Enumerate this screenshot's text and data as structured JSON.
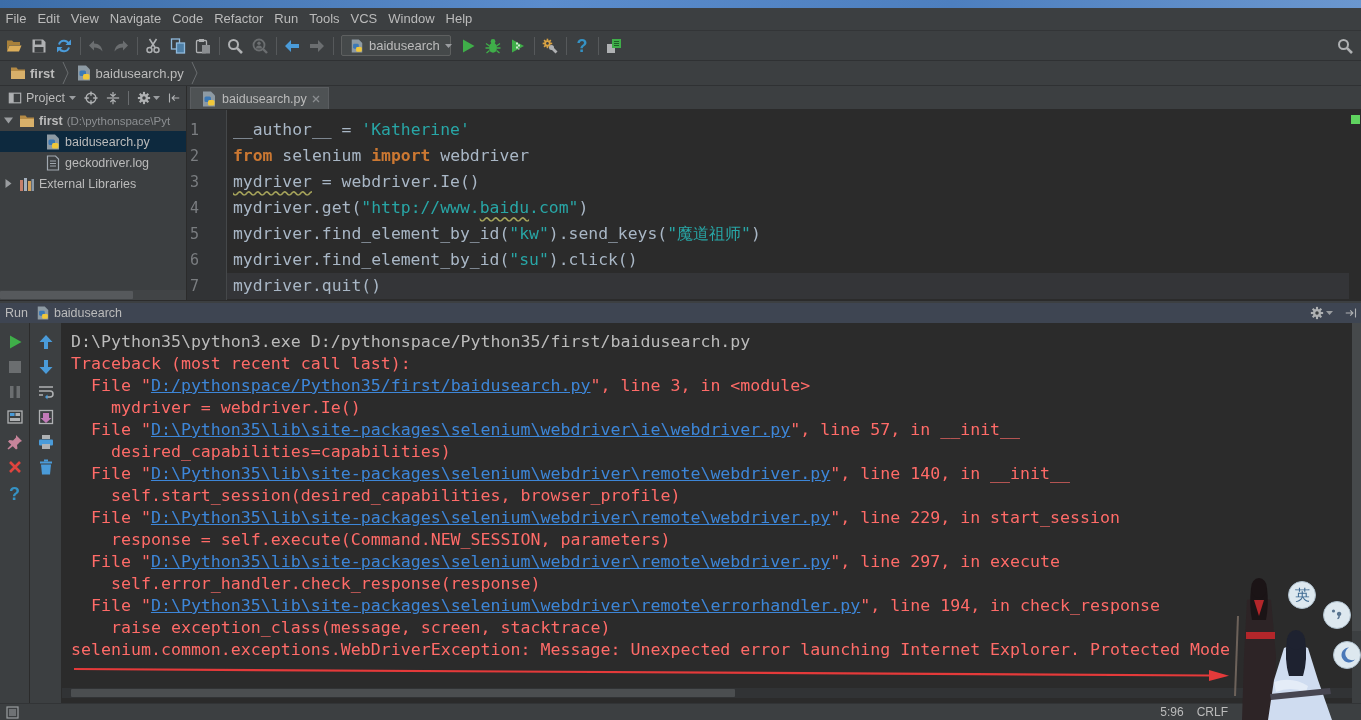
{
  "menu_bar": {
    "items": [
      "File",
      "Edit",
      "View",
      "Navigate",
      "Code",
      "Refactor",
      "Run",
      "Tools",
      "VCS",
      "Window",
      "Help"
    ]
  },
  "toolbar": {
    "groups": [
      [
        {
          "kind": "open",
          "disabled": false
        },
        {
          "kind": "save",
          "disabled": false
        },
        {
          "kind": "sync",
          "disabled": false
        }
      ],
      [
        {
          "kind": "undo",
          "disabled": true
        },
        {
          "kind": "redo",
          "disabled": true
        }
      ],
      [
        {
          "kind": "cut",
          "disabled": false
        },
        {
          "kind": "copy",
          "disabled": false
        },
        {
          "kind": "paste",
          "disabled": false
        }
      ],
      [
        {
          "kind": "find",
          "disabled": false
        },
        {
          "kind": "replace",
          "disabled": true
        }
      ],
      [
        {
          "kind": "back",
          "disabled": false
        },
        {
          "kind": "forward",
          "disabled": true
        }
      ],
      [
        {
          "kind": "run_config",
          "label": "baidusearch",
          "disabled": false
        },
        {
          "kind": "run",
          "disabled": false
        },
        {
          "kind": "debug",
          "disabled": false
        },
        {
          "kind": "coverage",
          "disabled": false
        }
      ],
      [
        {
          "kind": "settings",
          "disabled": false
        }
      ],
      [
        {
          "kind": "help",
          "glyph": "?",
          "disabled": false
        }
      ],
      [
        {
          "kind": "sdk",
          "disabled": false
        }
      ]
    ]
  },
  "navigation_bar": {
    "crumbs": [
      {
        "kind": "project",
        "label": "first"
      },
      {
        "kind": "python",
        "label": "baidusearch.py"
      }
    ]
  },
  "project_panel": {
    "title": "Project",
    "tree": [
      {
        "kind": "project",
        "label": "first",
        "path": "(D:\\pythonspace\\Pyt",
        "expanded": true,
        "selected": false,
        "children": [
          {
            "kind": "python",
            "label": "baidusearch.py",
            "selected": true
          },
          {
            "kind": "log",
            "label": "geckodriver.log",
            "selected": false
          }
        ]
      },
      {
        "kind": "library",
        "label": "External Libraries",
        "expanded": false,
        "selected": false
      }
    ]
  },
  "editor": {
    "tabs": [
      {
        "label": "baidusearch.py",
        "selected": true
      }
    ],
    "lines": [
      {
        "number": "1",
        "current": false,
        "tokens": [
          {
            "kind": "plain",
            "text": "__author__ = "
          },
          {
            "kind": "string",
            "text": "'Katherine'"
          }
        ]
      },
      {
        "number": "2",
        "current": false,
        "tokens": [
          {
            "kind": "keyword",
            "text": "from"
          },
          {
            "kind": "plain",
            "text": " selenium "
          },
          {
            "kind": "keyword",
            "text": "import"
          },
          {
            "kind": "plain",
            "text": " webdriver"
          }
        ]
      },
      {
        "number": "3",
        "current": false,
        "tokens": [
          {
            "kind": "typo",
            "text": "mydriver"
          },
          {
            "kind": "plain",
            "text": " = webdriver.Ie()"
          }
        ]
      },
      {
        "number": "4",
        "current": false,
        "tokens": [
          {
            "kind": "plain",
            "text": "mydriver.get("
          },
          {
            "kind": "string",
            "text": "\"http://www."
          },
          {
            "kind": "string_typo",
            "text": "baidu"
          },
          {
            "kind": "string",
            "text": ".com\""
          },
          {
            "kind": "plain",
            "text": ")"
          }
        ]
      },
      {
        "number": "5",
        "current": false,
        "tokens": [
          {
            "kind": "plain",
            "text": "mydriver.find_element_by_id("
          },
          {
            "kind": "string",
            "text": "\"kw\""
          },
          {
            "kind": "plain",
            "text": ").send_keys("
          },
          {
            "kind": "string",
            "text": "\"魔道祖师\""
          },
          {
            "kind": "plain",
            "text": ")"
          }
        ]
      },
      {
        "number": "6",
        "current": false,
        "tokens": [
          {
            "kind": "plain",
            "text": "mydriver.find_element_by_id("
          },
          {
            "kind": "string",
            "text": "\"su\""
          },
          {
            "kind": "plain",
            "text": ").click()"
          }
        ]
      },
      {
        "number": "7",
        "current": true,
        "tokens": [
          {
            "kind": "plain",
            "text": "mydriver.quit()"
          }
        ]
      }
    ]
  },
  "run_panel": {
    "title": "Run",
    "config": "baidusearch",
    "left_tools": [
      {
        "kind": "rerun",
        "disabled": false
      },
      {
        "kind": "stop",
        "disabled": true
      },
      {
        "kind": "pause",
        "disabled": true
      },
      {
        "kind": "layout",
        "disabled": false
      },
      {
        "kind": "pin",
        "disabled": false
      },
      {
        "kind": "close",
        "disabled": false
      },
      {
        "kind": "help",
        "glyph": "?",
        "disabled": false
      }
    ],
    "right_tools": [
      {
        "kind": "up",
        "disabled": false
      },
      {
        "kind": "down",
        "disabled": false
      },
      {
        "kind": "wrap",
        "disabled": false
      },
      {
        "kind": "scroll_end",
        "disabled": false
      },
      {
        "kind": "print",
        "disabled": false
      },
      {
        "kind": "trash",
        "disabled": false
      }
    ],
    "console": [
      {
        "kind": "command",
        "text": "D:\\Python35\\python3.exe D:/pythonspace/Python35/first/baidusearch.py"
      },
      {
        "kind": "error",
        "text": "Traceback (most recent call last):"
      },
      {
        "kind": "frame",
        "before": "File \"",
        "link": "D:/pythonspace/Python35/first/baidusearch.py",
        "after": "\", line 3, in <module>"
      },
      {
        "kind": "source",
        "text": "mydriver = webdriver.Ie()"
      },
      {
        "kind": "frame",
        "before": "File \"",
        "link": "D:\\Python35\\lib\\site-packages\\selenium\\webdriver\\ie\\webdriver.py",
        "after": "\", line 57, in __init__"
      },
      {
        "kind": "source",
        "text": "desired_capabilities=capabilities)"
      },
      {
        "kind": "frame",
        "before": "File \"",
        "link": "D:\\Python35\\lib\\site-packages\\selenium\\webdriver\\remote\\webdriver.py",
        "after": "\", line 140, in __init__"
      },
      {
        "kind": "source",
        "text": "self.start_session(desired_capabilities, browser_profile)"
      },
      {
        "kind": "frame",
        "before": "File \"",
        "link": "D:\\Python35\\lib\\site-packages\\selenium\\webdriver\\remote\\webdriver.py",
        "after": "\", line 229, in start_session"
      },
      {
        "kind": "source",
        "text": "response = self.execute(Command.NEW_SESSION, parameters)"
      },
      {
        "kind": "frame",
        "before": "File \"",
        "link": "D:\\Python35\\lib\\site-packages\\selenium\\webdriver\\remote\\webdriver.py",
        "after": "\", line 297, in execute"
      },
      {
        "kind": "source",
        "text": "self.error_handler.check_response(response)"
      },
      {
        "kind": "frame",
        "before": "File \"",
        "link": "D:\\Python35\\lib\\site-packages\\selenium\\webdriver\\remote\\errorhandler.py",
        "after": "\", line 194, in check_response"
      },
      {
        "kind": "source",
        "text": "raise exception_class(message, screen, stacktrace)"
      },
      {
        "kind": "error",
        "text": "selenium.common.exceptions.WebDriverException: Message: Unexpected error launching Internet Explorer. Protected Mode"
      }
    ]
  },
  "status_bar": {
    "position": "5:96",
    "line_separator": "CRLF"
  },
  "ime_toolbar": {
    "buttons": [
      {
        "kind": "text",
        "label": "英"
      },
      {
        "kind": "punctuation"
      },
      {
        "kind": "moon"
      }
    ]
  }
}
